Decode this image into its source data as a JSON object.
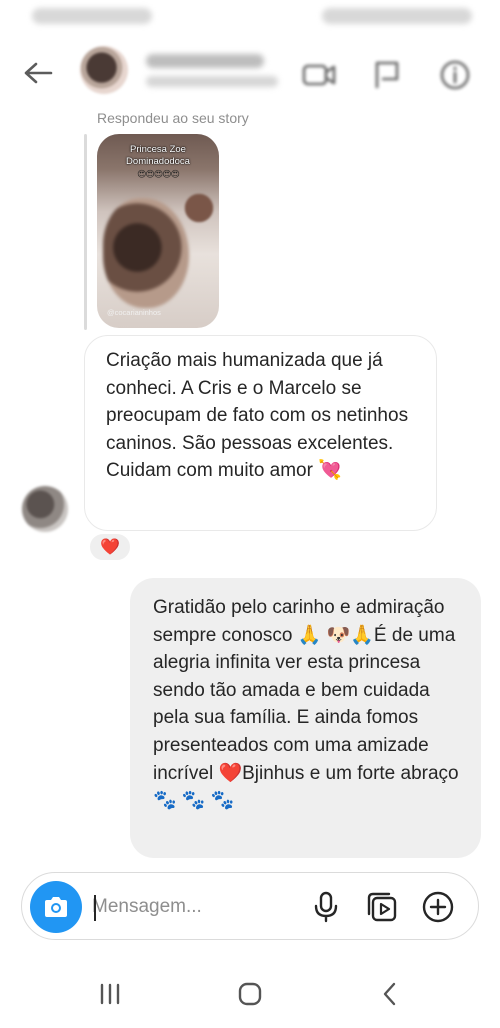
{
  "chat": {
    "reply_label": "Respondeu ao seu story",
    "story": {
      "title_line1": "Princesa Zoe",
      "title_line2": "Dominadodoca",
      "emojis": "😍😍😍😍😍",
      "watermark": "@cocarianinhos"
    },
    "incoming": {
      "text": "Criação mais humanizada que já conheci. A Cris e o Marcelo se preocupam de fato com os netinhos caninos. São pessoas excelentes.  Cuidam com muito amor 💘",
      "reaction": "❤️"
    },
    "outgoing": {
      "text": "Gratidão pelo carinho e admiração sempre conosco 🙏 🐶🙏É de uma alegria infinita ver esta princesa sendo tão amada e bem cuidada pela sua família. E ainda fomos presenteados com uma amizade incrível ❤️Bjinhus e um forte abraço 🐾 🐾 🐾"
    }
  },
  "composer": {
    "placeholder": "Mensagem...",
    "icons": [
      "camera-icon",
      "microphone-icon",
      "gallery-icon",
      "add-icon"
    ],
    "camera_color": "#2196F3"
  },
  "header": {
    "icons": [
      "back-arrow-icon",
      "video-call-icon",
      "flag-icon",
      "info-icon"
    ]
  },
  "navbar": {
    "icons": [
      "recent-apps-icon",
      "home-icon",
      "back-icon"
    ]
  }
}
